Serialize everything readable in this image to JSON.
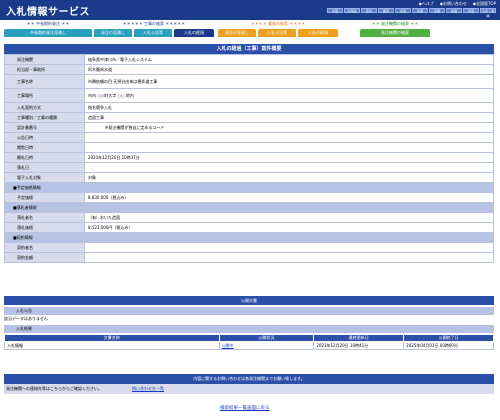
{
  "header": {
    "title": "入札情報サービス",
    "links": [
      "◆ヘルプ",
      "◆お問い合わせ",
      "◆全国版TOP"
    ],
    "regions": [
      "全国",
      "北海道",
      "東北",
      "関東",
      "北陸",
      "中部",
      "近畿",
      "中国",
      "四国",
      "九州・沖縄"
    ]
  },
  "menu": {
    "groups": [
      {
        "title": "＊＊ 中長期的発注 ＊＊",
        "tabs": [
          {
            "label": "中長期的発注見通し",
            "color": "#2a9fc0"
          }
        ]
      },
      {
        "title": "＊＊＊＊＊ 工事の検索 ＊＊＊＊＊",
        "tabs": [
          {
            "label": "発注の見通し",
            "color": "#2a9fc0"
          },
          {
            "label": "入札公告等",
            "color": "#2a9fc0"
          },
          {
            "label": "入札の経過",
            "color": "#1b3a8a"
          }
        ]
      },
      {
        "title": "＊＊＊＊ 業務の検索 ＊＊＊＊",
        "tabs": [
          {
            "label": "発注の見通し",
            "color": "#f0a020"
          },
          {
            "label": "入札公告等",
            "color": "#f0a020"
          },
          {
            "label": "入札の経過",
            "color": "#f0a020"
          }
        ]
      },
      {
        "title": "＊＊ 発注機関の検索 ＊＊",
        "tabs": [
          {
            "label": "発注機関の検索",
            "color": "#50b040"
          }
        ]
      }
    ]
  },
  "section_title": "入札の経過（工事）案件概要",
  "detail": {
    "rows": [
      {
        "label": "発注機関",
        "value": "岐阜県中津川市／電子入札システム"
      },
      {
        "label": "担当部・事務所",
        "value": "阿木簡易水道"
      },
      {
        "label": "工事名称",
        "value": "市隣依頼の目 天然谷由来は攪拌道工事"
      },
      {
        "label": "工事場所",
        "value": "市内 ○○町大字 ○○ 地内"
      },
      {
        "label": "入札契約方式",
        "value": "指名競争入札"
      },
      {
        "label": "工事種別／工事の種類",
        "value": "造園工事"
      },
      {
        "label": "設計書番号",
        "value": "※発注機関が独自に定めるコード"
      },
      {
        "label": "公告日時",
        "value": ""
      },
      {
        "label": "閲覧日時",
        "value": ""
      },
      {
        "label": "開札日時",
        "value": "2023年12月20日 10時37分"
      },
      {
        "label": "落札日",
        "value": ""
      },
      {
        "label": "電子入札対象",
        "value": "対象"
      }
    ],
    "sub_price": "■予定価格情報",
    "price_rows": [
      {
        "label": "予定価格",
        "value": "8,830,000（税込み）"
      }
    ],
    "sub_bidder": "■落札者情報",
    "bidder_rows": [
      {
        "label": "落札者名",
        "value": "（有）おいた造園"
      },
      {
        "label": "落札価格",
        "value": "8,523,000円（税込み）"
      }
    ],
    "sub_contract": "■契約情報",
    "contract_rows": [
      {
        "label": "契約者名",
        "value": ""
      },
      {
        "label": "契約金額",
        "value": ""
      }
    ]
  },
  "public_docs": {
    "title": "公開文書",
    "notice_label": "入札公告",
    "notice_text": "該当データはありません",
    "result_label": "入札結果",
    "columns": [
      "文書名称",
      "公開状況",
      "最終更新日",
      "公開終了日"
    ],
    "rows": [
      {
        "name": "入札情報",
        "status": "公開中",
        "updated": "2023年12月20日 10時41分",
        "end": "2025年04月01日 00時00分"
      }
    ]
  },
  "footer": {
    "bar_text": "内容に関するお問い合わせは各発注機関までお願い致します。",
    "row_text": "発注機関への連絡先等はこちらからご確認ください。",
    "contact_link": "問い合わせ先一覧",
    "back_link": "検索結果一覧画面に戻る"
  }
}
